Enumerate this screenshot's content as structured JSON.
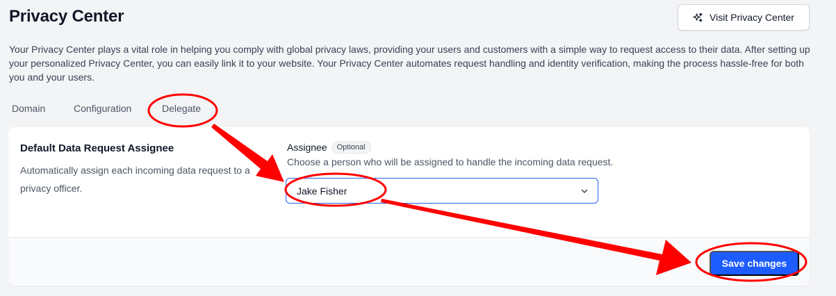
{
  "header": {
    "title": "Privacy Center",
    "visit_button_label": "Visit Privacy Center",
    "visit_button_icon": "sparkles-icon"
  },
  "description": "Your Privacy Center plays a vital role in helping you comply with global privacy laws, providing your users and customers with a simple way to request access to their data. After setting up your personalized Privacy Center, you can easily link it to your website. Your Privacy Center automates request handling and identity verification, making the process hassle-free for both you and your users.",
  "tabs": [
    {
      "label": "Domain"
    },
    {
      "label": "Configuration"
    },
    {
      "label": "Delegate"
    }
  ],
  "section": {
    "title": "Default Data Request Assignee",
    "description": "Automatically assign each incoming data request to a privacy officer."
  },
  "assignee": {
    "label": "Assignee",
    "badge": "Optional",
    "help": "Choose a person who will be assigned to handle the incoming data request.",
    "selected": "Jake Fisher",
    "dropdown_icon": "chevron-down-icon"
  },
  "footer": {
    "save_label": "Save changes"
  },
  "annotation_color": "#ff0000",
  "accent_color": "#1d5cff"
}
